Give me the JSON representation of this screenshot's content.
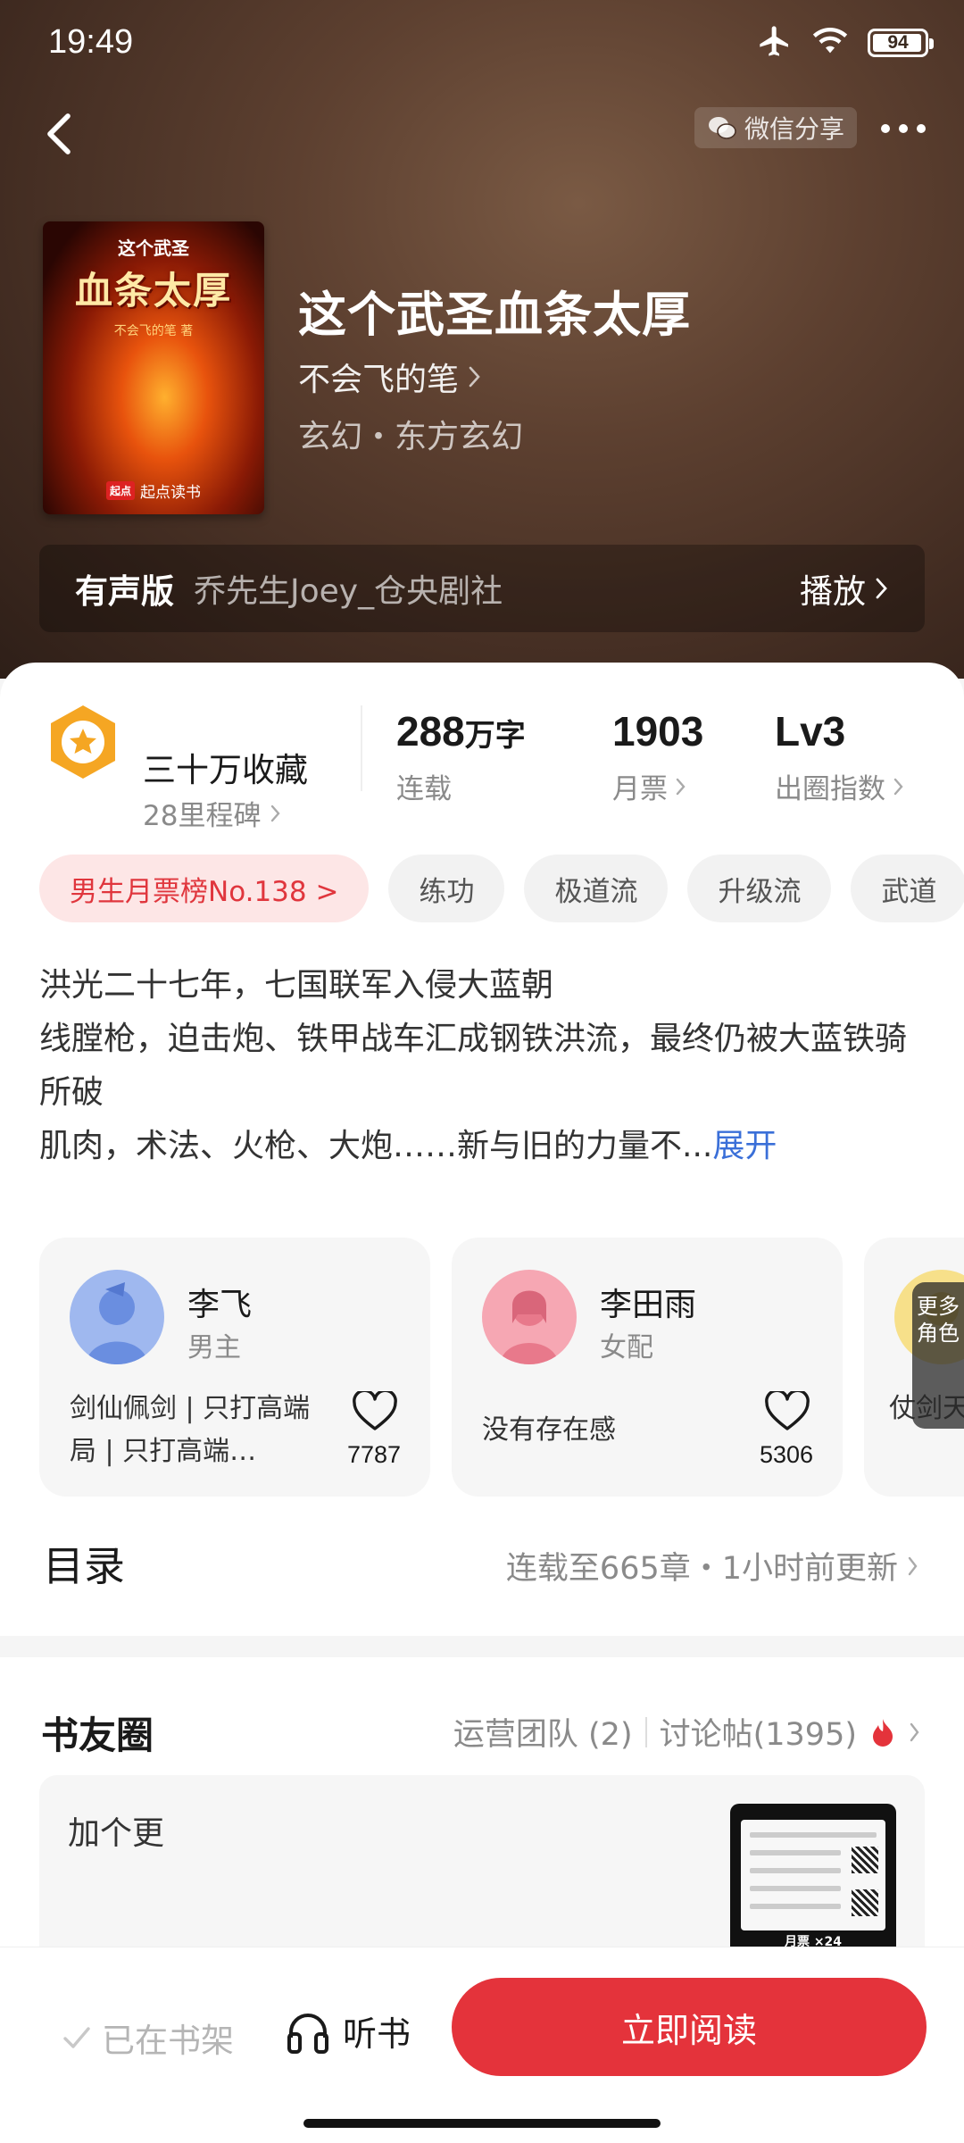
{
  "status_bar": {
    "time": "19:49",
    "battery": "94"
  },
  "header": {
    "share_label": "微信分享"
  },
  "book": {
    "cover_small": "这个武圣",
    "cover_title": "血条太厚",
    "cover_author": "不会飞的笔 著",
    "cover_publisher": "起点读书",
    "title": "这个武圣血条太厚",
    "author": "不会飞的笔",
    "genre": "玄幻・东方玄幻"
  },
  "audio": {
    "label": "有声版",
    "narrator": "乔先生Joey_仓央剧社",
    "play": "播放"
  },
  "stats": {
    "collect": "三十万收藏",
    "milestone": "28里程碑",
    "words_num": "288",
    "words_unit": "万字",
    "words_label": "连载",
    "tickets_num": "1903",
    "tickets_label": "月票",
    "level_num": "Lv3",
    "level_label": "出圈指数"
  },
  "tags": [
    "男生月票榜No.138 >",
    "练功",
    "极道流",
    "升级流",
    "武道"
  ],
  "synopsis": {
    "line1": "洪光二十七年，七国联军入侵大蓝朝",
    "line2": "线膛枪，迫击炮、铁甲战车汇成钢铁洪流，最终仍被大蓝铁骑所破",
    "line3": "肌肉，术法、火枪、大炮……新与旧的力量不...",
    "expand": "展开"
  },
  "roles": [
    {
      "name": "李飞",
      "type": "男主",
      "desc": "剑仙佩剑 | 只打高端局 | 只打高端…",
      "likes": "7787"
    },
    {
      "name": "李田雨",
      "type": "女配",
      "desc": "没有存在感",
      "likes": "5306"
    },
    {
      "desc": "仗剑天涯 | 真女主"
    }
  ],
  "more_roles": "更多角色",
  "toc": {
    "title": "目录",
    "info": "连载至665章・1小时前更新"
  },
  "community": {
    "title": "书友圈",
    "team": "运营团队 (2)",
    "posts": "讨论帖(1395)",
    "post_text": "加个更",
    "thumb_label": "月票 ×24"
  },
  "bottom": {
    "shelf": "已在书架",
    "listen": "听书",
    "read": "立即阅读"
  },
  "colors": {
    "accent": "#e4333b",
    "link": "#3a6fd8",
    "medal": "#f5a623"
  }
}
